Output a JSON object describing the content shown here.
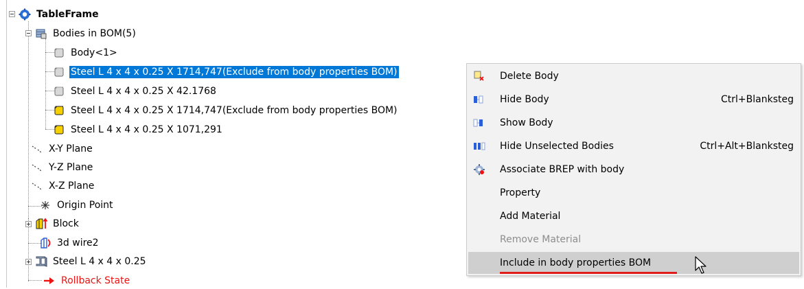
{
  "tree": {
    "root": {
      "label": "TableFrame",
      "icon": "assembly-gear-icon"
    },
    "bodies_folder": {
      "label": "Bodies in BOM(5)",
      "icon": "bodies-folder-icon"
    },
    "bodies": [
      {
        "label": "Body<1>",
        "icon": "body-gray-icon",
        "selected": false
      },
      {
        "label": "Steel L 4 x 4 x 0.25 X 1714,747(Exclude from body properties BOM)",
        "icon": "body-gray-icon",
        "selected": true
      },
      {
        "label": "Steel L 4 x 4 x 0.25 X 42.1768",
        "icon": "body-gray-icon",
        "selected": false
      },
      {
        "label": "Steel L 4 x 4 x 0.25 X 1714,747(Exclude from body properties BOM)",
        "icon": "body-yellow-icon",
        "selected": false
      },
      {
        "label": "Steel L 4 x 4 x 0.25 X 1071,291",
        "icon": "body-yellow-icon",
        "selected": false
      }
    ],
    "planes": [
      {
        "label": "X-Y Plane",
        "icon": "plane-icon"
      },
      {
        "label": "Y-Z Plane",
        "icon": "plane-icon"
      },
      {
        "label": "X-Z Plane",
        "icon": "plane-icon"
      }
    ],
    "origin": {
      "label": "Origin Point",
      "icon": "origin-point-icon"
    },
    "block": {
      "label": "Block",
      "icon": "block-icon"
    },
    "wire": {
      "label": "3d wire2",
      "icon": "3d-wire-icon"
    },
    "steel": {
      "label": "Steel L 4 x 4 x 0.25",
      "icon": "steel-profile-icon"
    },
    "rollback": {
      "label": "Rollback State",
      "icon": "rollback-arrow-icon",
      "color": "#e11111"
    }
  },
  "selection_color": "#0078d7",
  "context_menu": {
    "items": [
      {
        "label": "Delete Body",
        "shortcut": "",
        "icon": "delete-body-icon",
        "enabled": true
      },
      {
        "label": "Hide Body",
        "shortcut": "Ctrl+Blanksteg",
        "icon": "hide-body-icon",
        "enabled": true
      },
      {
        "label": "Show Body",
        "shortcut": "",
        "icon": "show-body-icon",
        "enabled": true
      },
      {
        "label": "Hide Unselected Bodies",
        "shortcut": "Ctrl+Alt+Blanksteg",
        "icon": "hide-unselected-icon",
        "enabled": true
      },
      {
        "label": "Associate BREP with body",
        "shortcut": "",
        "icon": "associate-brep-icon",
        "enabled": true
      },
      {
        "label": "Property",
        "shortcut": "",
        "icon": "",
        "enabled": true
      },
      {
        "label": "Add Material",
        "shortcut": "",
        "icon": "",
        "enabled": true
      },
      {
        "label": "Remove Material",
        "shortcut": "",
        "icon": "",
        "enabled": false
      },
      {
        "label": "Include in body properties BOM",
        "shortcut": "",
        "icon": "",
        "enabled": true,
        "hovered": true
      }
    ],
    "highlight_underline_color": "#e21b1b"
  }
}
